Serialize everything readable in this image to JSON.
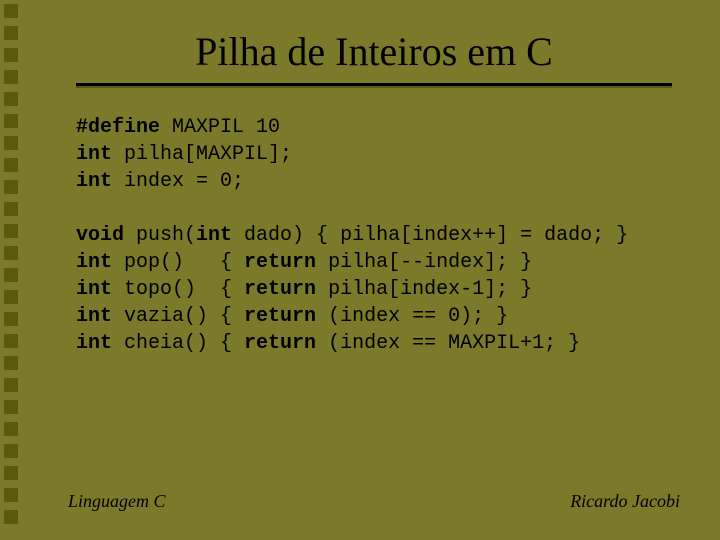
{
  "title": "Pilha de Inteiros em C",
  "code": {
    "l1a": "#define",
    "l1b": " MAXPIL 10",
    "l2a": "int",
    "l2b": " pilha[MAXPIL];",
    "l3a": "int",
    "l3b": " index = 0;",
    "l5a": "void",
    "l5b": " push(",
    "l5c": "int",
    "l5d": " dado) { pilha[index++] = dado; }",
    "l6a": "int",
    "l6b": " pop()   { ",
    "l6c": "return",
    "l6d": " pilha[--index]; }",
    "l7a": "int",
    "l7b": " topo()  { ",
    "l7c": "return",
    "l7d": " pilha[index-1]; }",
    "l8a": "int",
    "l8b": " vazia() { ",
    "l8c": "return",
    "l8d": " (index == 0); }",
    "l9a": "int",
    "l9b": " cheia() { ",
    "l9c": "return",
    "l9d": " (index == MAXPIL+1; }"
  },
  "footer": {
    "left": "Linguagem C",
    "right": "Ricardo Jacobi"
  }
}
